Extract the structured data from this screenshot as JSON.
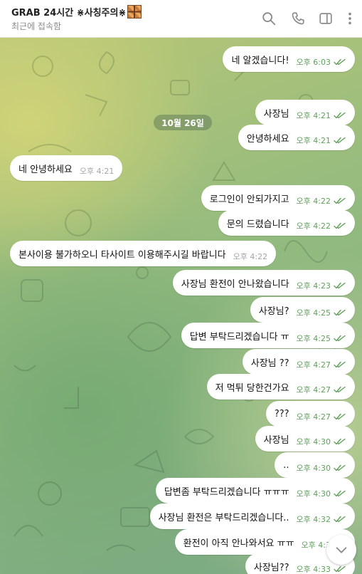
{
  "header": {
    "title": "GRAB 24시간 ⋇사칭주의⋇",
    "status": "최근에 접속함"
  },
  "date_chip": "10월 26일",
  "messages": [
    {
      "text": "네 알겠습니다!",
      "time": "오후 6:03",
      "dir": "out"
    },
    {
      "text": "사장님",
      "time": "오후 4:21",
      "dir": "out"
    },
    {
      "text": "안녕하세요",
      "time": "오후 4:21",
      "dir": "out"
    },
    {
      "text": "네 안녕하세요",
      "time": "오후 4:21",
      "dir": "in"
    },
    {
      "text": "로그인이 안되가지고",
      "time": "오후 4:22",
      "dir": "out"
    },
    {
      "text": "문의 드렸습니다",
      "time": "오후 4:22",
      "dir": "out"
    },
    {
      "text": "본사이용 불가하오니 타사이트 이용해주시길 바랍니다",
      "time": "오후 4:22",
      "dir": "in"
    },
    {
      "text": "사장님 환전이 안나왔습니다",
      "time": "오후 4:23",
      "dir": "out"
    },
    {
      "text": "사장님?",
      "time": "오후 4:25",
      "dir": "out"
    },
    {
      "text": "답변 부탁드리겠습니다 ㅠ",
      "time": "오후 4:25",
      "dir": "out"
    },
    {
      "text": "사장님 ??",
      "time": "오후 4:27",
      "dir": "out"
    },
    {
      "text": "저 먹튀 당한건가요",
      "time": "오후 4:27",
      "dir": "out"
    },
    {
      "text": "???",
      "time": "오후 4:27",
      "dir": "out"
    },
    {
      "text": "사장님",
      "time": "오후 4:30",
      "dir": "out"
    },
    {
      "text": "..",
      "time": "오후 4:30",
      "dir": "out"
    },
    {
      "text": "답변좀 부탁드리겠습니다 ㅠㅠㅠ",
      "time": "오후 4:30",
      "dir": "out"
    },
    {
      "text": "사장님 환전은 부탁드리겠습니다..",
      "time": "오후 4:32",
      "dir": "out"
    },
    {
      "text": "환전이 아직 안나와서요 ㅠㅠ",
      "time": "오후 4:3",
      "dir": "out"
    },
    {
      "text": "사장님??",
      "time": "오후 4:33",
      "dir": "out"
    }
  ],
  "icons": {
    "search": "search-icon",
    "call": "phone-icon",
    "sidebar": "sidebar-toggle-icon",
    "more": "more-vertical-icon",
    "scroll": "chevron-down-icon"
  },
  "colors": {
    "check": "#5fa15a",
    "bubble": "#ffffff"
  }
}
